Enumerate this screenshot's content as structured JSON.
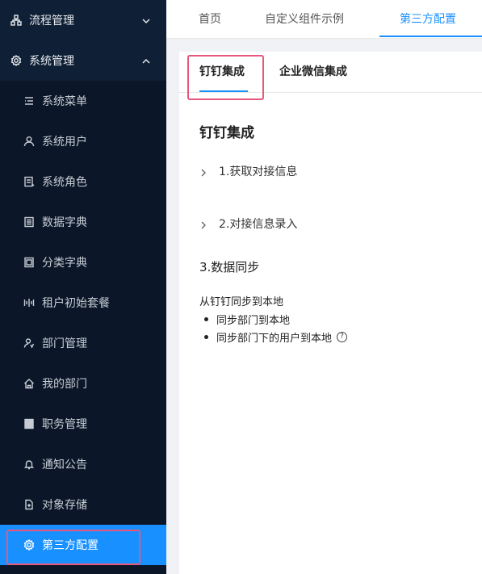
{
  "sidebar": {
    "workflow": "流程管理",
    "system": "系统管理",
    "items": [
      {
        "label": "系统菜单",
        "icon": "menu-list-icon"
      },
      {
        "label": "系统用户",
        "icon": "user-icon"
      },
      {
        "label": "系统角色",
        "icon": "role-icon"
      },
      {
        "label": "数据字典",
        "icon": "dictionary-icon"
      },
      {
        "label": "分类字典",
        "icon": "category-dictionary-icon"
      },
      {
        "label": "租户初始套餐",
        "icon": "package-icon"
      },
      {
        "label": "部门管理",
        "icon": "department-icon"
      },
      {
        "label": "我的部门",
        "icon": "home-icon"
      },
      {
        "label": "职务管理",
        "icon": "position-icon"
      },
      {
        "label": "通知公告",
        "icon": "bell-icon"
      },
      {
        "label": "对象存储",
        "icon": "file-icon"
      },
      {
        "label": "第三方配置",
        "icon": "gear-icon"
      }
    ]
  },
  "topnav": {
    "tabs": [
      "首页",
      "自定义组件示例",
      "第三方配置"
    ],
    "active": "第三方配置"
  },
  "content": {
    "subtabs": [
      "钉钉集成",
      "企业微信集成"
    ],
    "heading": "钉钉集成",
    "panel1": "1.获取对接信息",
    "panel2": "2.对接信息录入",
    "section3": "3.数据同步",
    "sync_desc": "从钉钉同步到本地",
    "bullets": [
      "同步部门到本地",
      "同步部门下的用户到本地"
    ],
    "help_glyph": "?"
  },
  "colors": {
    "sidebar_bg": "#0f1f35",
    "active": "#1890ff",
    "highlight": "#e8577a"
  }
}
